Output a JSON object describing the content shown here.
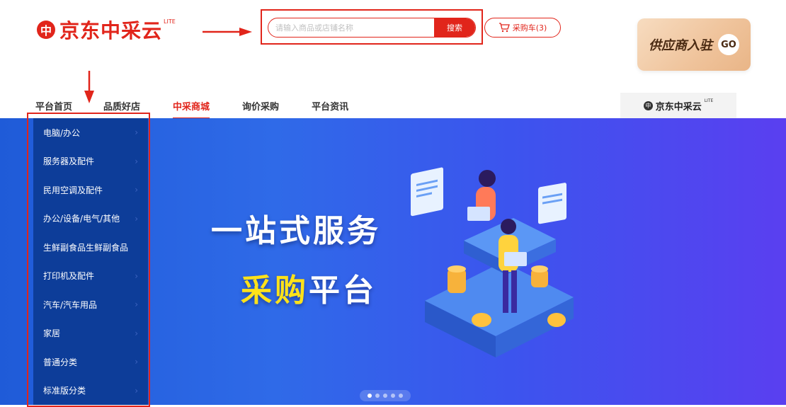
{
  "brand": {
    "logo_glyph": "中",
    "name": "京东中采云",
    "lite": "LITE"
  },
  "search": {
    "placeholder": "请输入商品或店铺名称",
    "button_label": "搜索"
  },
  "cart": {
    "label": "采购车(3)",
    "icon": "cart-icon"
  },
  "supplier_banner": {
    "text": "供应商入驻",
    "go": "GO"
  },
  "nav": {
    "items": [
      {
        "label": "平台首页",
        "active": false
      },
      {
        "label": "品质好店",
        "active": false
      },
      {
        "label": "中采商城",
        "active": true
      },
      {
        "label": "询价采购",
        "active": false
      },
      {
        "label": "平台资讯",
        "active": false
      }
    ]
  },
  "mini_logo": {
    "glyph": "中",
    "name": "京东中采云",
    "lite": "LITE"
  },
  "categories": [
    "电脑/办公",
    "服务器及配件",
    "民用空调及配件",
    "办公/设备/电气/其他",
    "生鲜副食品生鲜副食品",
    "打印机及配件",
    "汽车/汽车用品",
    "家居",
    "普通分类",
    "标准版分类"
  ],
  "hero": {
    "title_line1": "一站式服务",
    "title_line2_highlight": "采购",
    "title_line2_rest": "平台",
    "carousel_slides": 5,
    "active_slide": 0
  },
  "colors": {
    "brand_red": "#e1251b",
    "category_panel": "#0d3d99",
    "hero_start": "#1f5bd8",
    "hero_end": "#5a3ff0",
    "highlight_yellow": "#ffe21a"
  }
}
